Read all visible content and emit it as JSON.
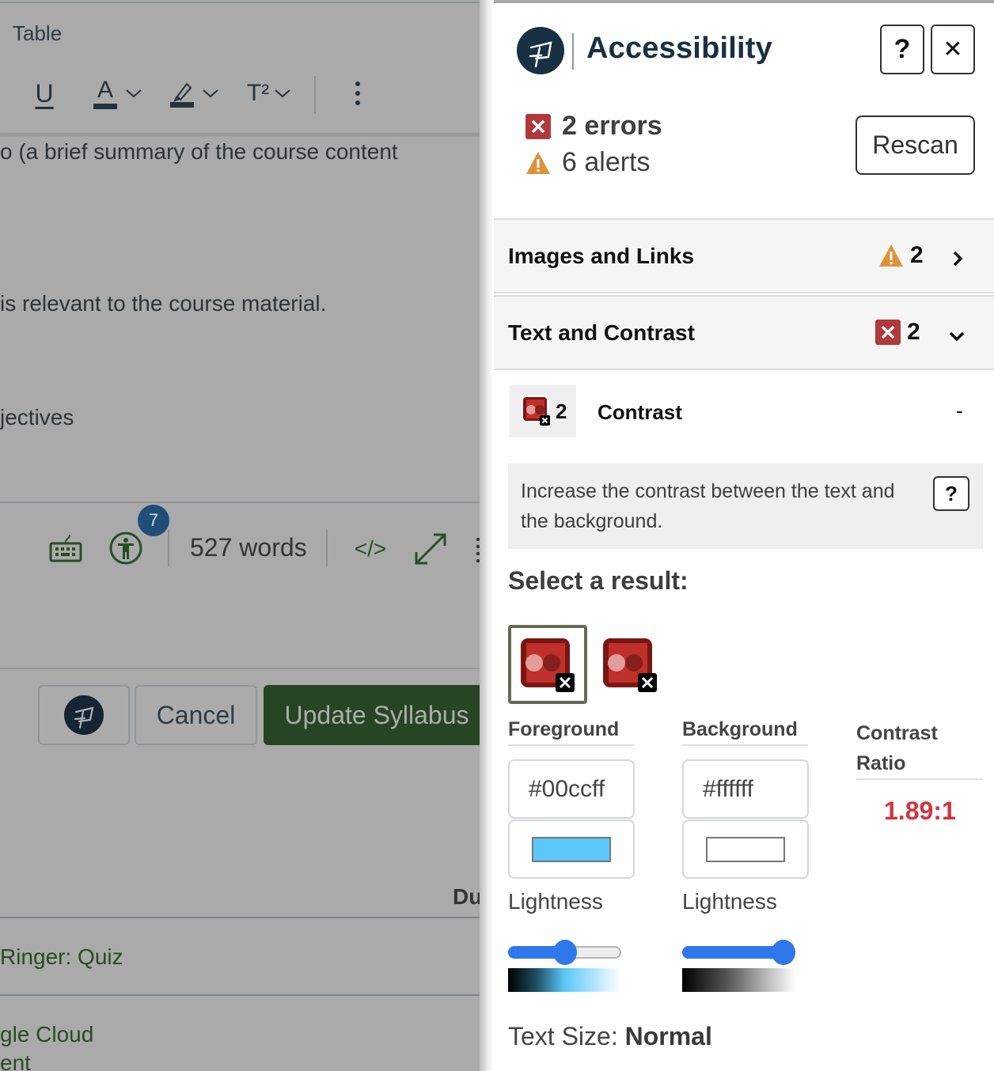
{
  "editor": {
    "menu_table": "Table",
    "toolbar": {
      "underline": "U",
      "text_color": "A",
      "superscript": "T²"
    },
    "body_lines": [
      "o (a brief summary of the course content",
      "is relevant to the course material.",
      "jectives"
    ],
    "status_bar": {
      "a11y_badge_count": "7",
      "word_count": "527 words",
      "html_toggle": "</>"
    },
    "buttons": {
      "cancel": "Cancel",
      "update": "Update Syllabus"
    },
    "table": {
      "due_header": "Due",
      "rows": [
        {
          "line1": "Ringer: Quiz"
        },
        {
          "line1": "gle Cloud",
          "line2": "ent"
        }
      ]
    }
  },
  "panel": {
    "title": "Accessibility",
    "help_button": "?",
    "close_button": "✕",
    "summary": {
      "errors": "2 errors",
      "alerts": "6 alerts"
    },
    "rescan_label": "Rescan",
    "categories": [
      {
        "label": "Images and Links",
        "count": "2",
        "severity": "alert",
        "expanded": false
      },
      {
        "label": "Text and Contrast",
        "count": "2",
        "severity": "error",
        "expanded": true
      }
    ],
    "rule": {
      "count": "2",
      "label": "Contrast",
      "toggle": "-"
    },
    "info": {
      "text": "Increase the contrast between the text and the background.",
      "help": "?"
    },
    "select_result_label": "Select a result:",
    "results": [
      {
        "selected": true
      },
      {
        "selected": false
      }
    ],
    "contrast": {
      "foreground_label": "Foreground",
      "background_label": "Background",
      "ratio_label": "Contrast Ratio",
      "foreground_hex": "#00ccff",
      "background_hex": "#ffffff",
      "foreground_swatch": "#5bc8f9",
      "background_swatch": "#ffffff",
      "ratio": "1.89:1",
      "ratio_color": "#d1343f",
      "lightness_label": "Lightness",
      "foreground_lightness": 0.5,
      "background_lightness": 1.0
    },
    "text_size_label": "Text Size:",
    "text_size_value": "Normal"
  },
  "colors": {
    "error": "#b0393b",
    "alert": "#e0923a",
    "brand_dark": "#173142",
    "primary_green": "#274524",
    "slider_blue": "#2f78eb"
  }
}
